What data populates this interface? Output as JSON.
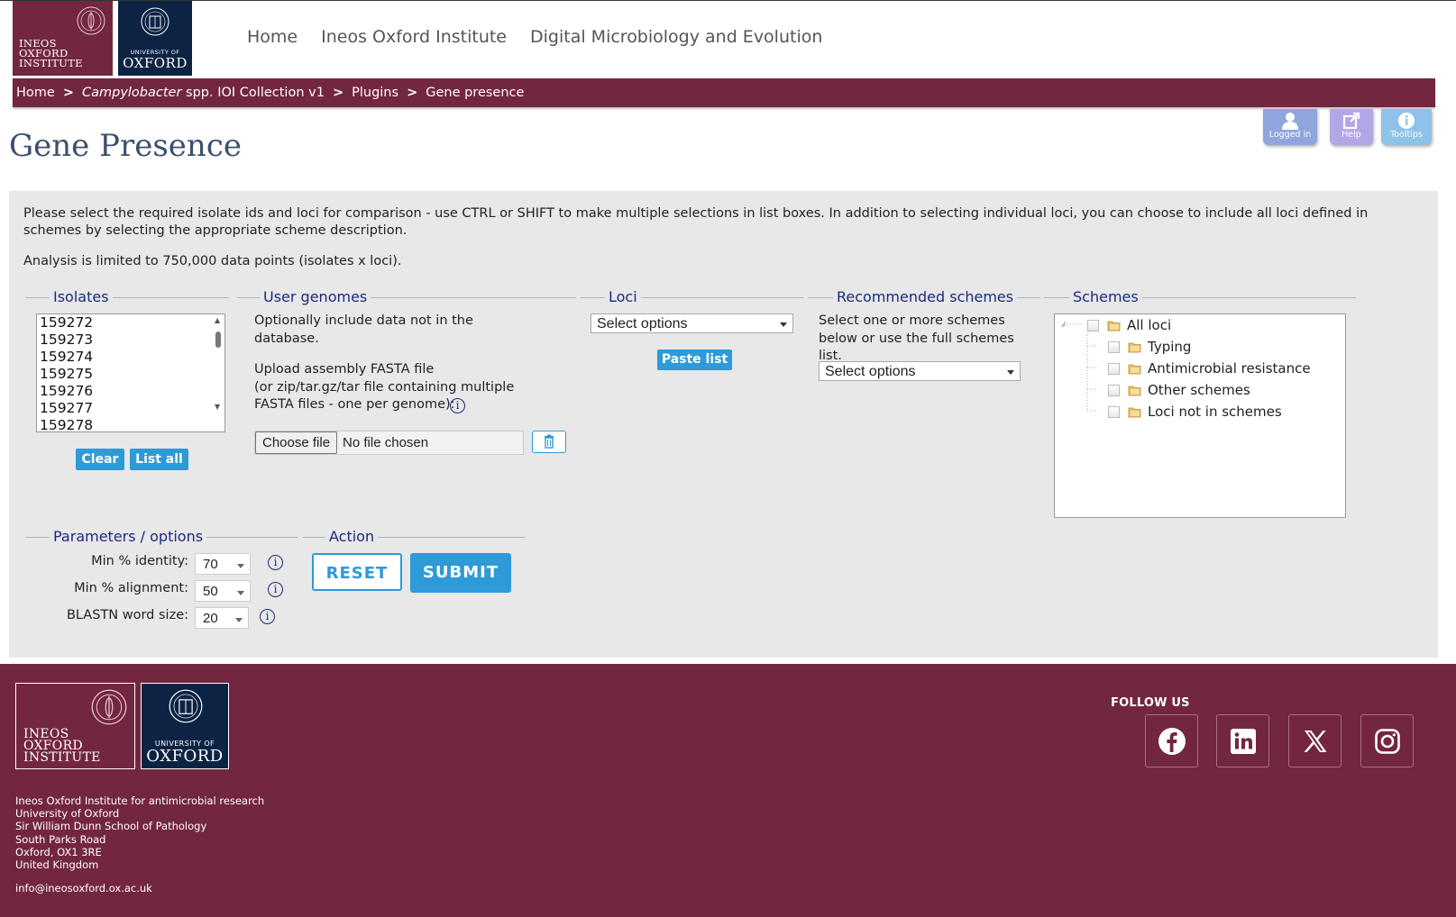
{
  "header": {
    "logo_ineos": [
      "INEOS",
      "OXFORD",
      "INSTITUTE"
    ],
    "logo_oxford_small": "UNIVERSITY OF",
    "logo_oxford_big": "OXFORD",
    "nav": [
      "Home",
      "Ineos Oxford Institute",
      "Digital Microbiology and Evolution"
    ]
  },
  "breadcrumb": {
    "home": "Home",
    "sep": ">",
    "collection_italic": "Campylobacter",
    "collection_rest": "spp. IOI Collection v1",
    "plugins": "Plugins",
    "current": "Gene presence"
  },
  "toolbar": {
    "logged_in": "Logged in",
    "help": "Help",
    "tooltips": "Tooltips"
  },
  "page_title": "Gene Presence",
  "intro": {
    "line1": "Please select the required isolate ids and loci for comparison - use CTRL or SHIFT to make multiple selections in list boxes. In addition to selecting individual loci, you can choose to include all loci defined in schemes by selecting the appropriate scheme description.",
    "line2": "Analysis is limited to 750,000 data points (isolates x loci)."
  },
  "isolates": {
    "legend": "Isolates",
    "items": [
      "159272",
      "159273",
      "159274",
      "159275",
      "159276",
      "159277",
      "159278"
    ],
    "clear": "Clear",
    "list_all": "List all"
  },
  "user_genomes": {
    "legend": "User genomes",
    "text1": "Optionally include data not in the database.",
    "text2a": "Upload assembly FASTA file",
    "text2b": "(or zip/tar.gz/tar file containing multiple FASTA files - one per genome):",
    "choose_file": "Choose file",
    "no_file": "No file chosen"
  },
  "loci": {
    "legend": "Loci",
    "select": "Select options",
    "paste_list": "Paste list"
  },
  "recommended": {
    "legend": "Recommended schemes",
    "text": "Select one or more schemes below or use the full schemes list.",
    "select": "Select options"
  },
  "schemes": {
    "legend": "Schemes",
    "root": "All loci",
    "children": [
      "Typing",
      "Antimicrobial resistance",
      "Other schemes",
      "Loci not in schemes"
    ]
  },
  "params": {
    "legend": "Parameters / options",
    "identity_label": "Min % identity:",
    "identity_value": "70",
    "alignment_label": "Min % alignment:",
    "alignment_value": "50",
    "word_label": "BLASTN word size:",
    "word_value": "20"
  },
  "action": {
    "legend": "Action",
    "reset": "RESET",
    "submit": "SUBMIT"
  },
  "footer": {
    "logo_ineos": [
      "INEOS",
      "OXFORD",
      "INSTITUTE"
    ],
    "logo_oxford_small": "UNIVERSITY OF",
    "logo_oxford_big": "OXFORD",
    "address": [
      "Ineos Oxford Institute for antimicrobial research",
      "University of Oxford",
      "Sir William Dunn School of Pathology",
      "South Parks Road",
      "Oxford, OX1 3RE",
      "United Kingdom"
    ],
    "email": "info@ineosoxford.ox.ac.uk",
    "follow_us": "FOLLOW US",
    "social_icons": [
      "facebook-icon",
      "linkedin-icon",
      "x-icon",
      "instagram-icon"
    ]
  },
  "colors": {
    "brand_maroon": "#732640",
    "oxford_navy": "#0c2344",
    "accent_blue": "#2e9ad7",
    "legend_navy": "#1a2a80",
    "panel_grey": "#e8e8e8",
    "toolbar_purple": "#8fa5dc"
  }
}
